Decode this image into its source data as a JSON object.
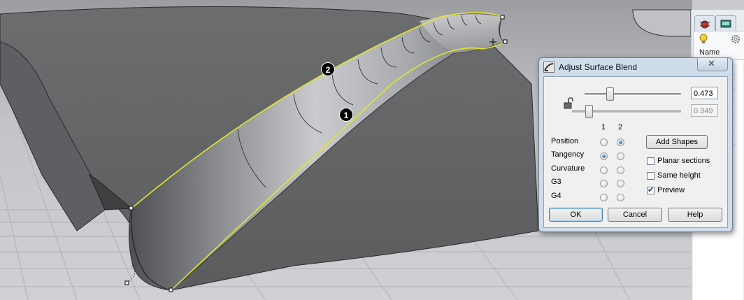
{
  "dialog": {
    "title": "Adjust Surface Blend",
    "close_glyph": "✕",
    "slider_1": {
      "value": "0.473",
      "fraction": 0.24
    },
    "slider_2": {
      "value": "0.349",
      "fraction": 0.13
    },
    "lock_icon": "unlocked-padlock-icon",
    "column_headers": [
      "1",
      "2"
    ],
    "continuity_rows": [
      {
        "label": "Position",
        "col1": false,
        "col2": true
      },
      {
        "label": "Tangency",
        "col1": true,
        "col2": false
      },
      {
        "label": "Curvature",
        "col1": false,
        "col2": false
      },
      {
        "label": "G3",
        "col1": false,
        "col2": false
      },
      {
        "label": "G4",
        "col1": false,
        "col2": false
      }
    ],
    "add_shapes_label": "Add Shapes",
    "options": [
      {
        "label": "Planar sections",
        "checked": false
      },
      {
        "label": "Same height",
        "checked": false
      },
      {
        "label": "Preview",
        "checked": true
      }
    ],
    "ok_label": "OK",
    "cancel_label": "Cancel",
    "help_label": "Help"
  },
  "viewport": {
    "markers": [
      {
        "label": "1"
      },
      {
        "label": "2"
      }
    ],
    "edge_color": "#e5e52a"
  },
  "right_panel": {
    "tabs": [
      "bug-icon",
      "display-icon"
    ],
    "subtabs": [
      "lightbulb-icon",
      "gear-icon"
    ],
    "header_label": "Name"
  }
}
